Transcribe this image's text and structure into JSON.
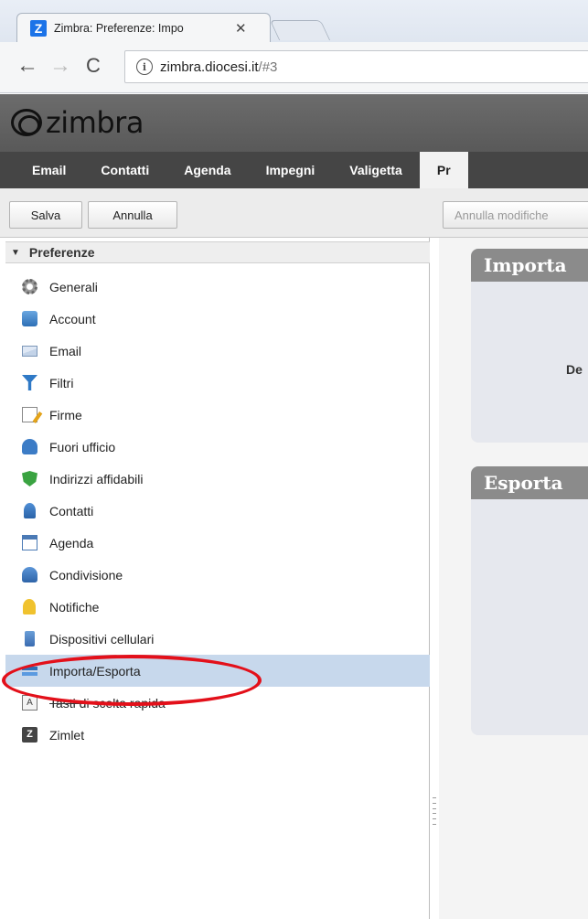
{
  "browser": {
    "tab_title": "Zimbra: Preferenze: Impo",
    "tab_icon": "Z",
    "url_host": "zimbra.diocesi.it",
    "url_path": "/#3"
  },
  "app": {
    "logo": "zimbra",
    "tabs": [
      {
        "label": "Email"
      },
      {
        "label": "Contatti"
      },
      {
        "label": "Agenda"
      },
      {
        "label": "Impegni"
      },
      {
        "label": "Valigetta"
      },
      {
        "label": "Pr"
      }
    ]
  },
  "toolbar": {
    "save_label": "Salva",
    "cancel_label": "Annulla",
    "undo_label": "Annulla modifiche"
  },
  "sidebar": {
    "header": "Preferenze",
    "items": [
      {
        "label": "Generali",
        "icon": "gear-icon"
      },
      {
        "label": "Account",
        "icon": "account-icon"
      },
      {
        "label": "Email",
        "icon": "envelope-icon"
      },
      {
        "label": "Filtri",
        "icon": "filter-icon"
      },
      {
        "label": "Firme",
        "icon": "signature-icon"
      },
      {
        "label": "Fuori ufficio",
        "icon": "out-of-office-icon"
      },
      {
        "label": "Indirizzi affidabili",
        "icon": "shield-icon"
      },
      {
        "label": "Contatti",
        "icon": "contact-icon"
      },
      {
        "label": "Agenda",
        "icon": "calendar-icon"
      },
      {
        "label": "Condivisione",
        "icon": "sharing-icon"
      },
      {
        "label": "Notifiche",
        "icon": "bell-icon"
      },
      {
        "label": "Dispositivi cellulari",
        "icon": "mobile-device-icon"
      },
      {
        "label": "Importa/Esporta",
        "icon": "import-export-icon"
      },
      {
        "label": "Tasti di scelta rapida",
        "icon": "keyboard-shortcut-icon"
      },
      {
        "label": "Zimlet",
        "icon": "zimlet-icon"
      }
    ],
    "selected_index": 12
  },
  "content": {
    "import_title": "Importa",
    "import_fragment": "De",
    "export_title": "Esporta"
  },
  "colors": {
    "highlight_ring": "#e3101a",
    "selected_row": "#c7d8ec",
    "app_tabs_bg": "#454545"
  }
}
